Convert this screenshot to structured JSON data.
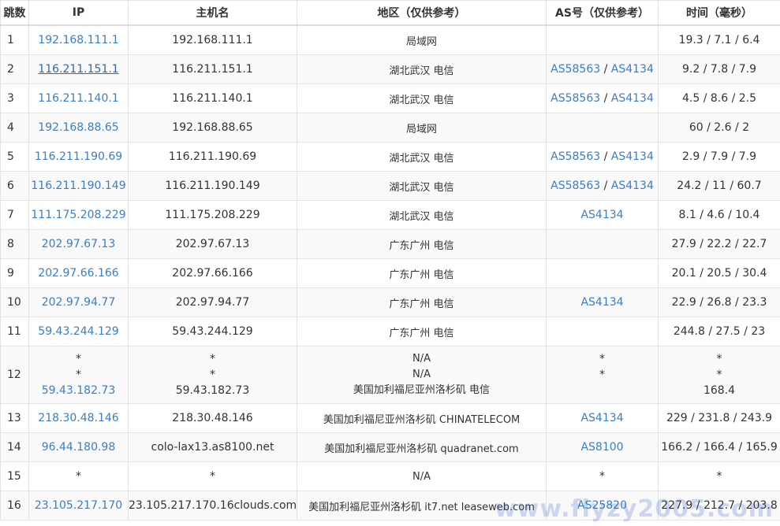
{
  "headers": {
    "hop": "跳数",
    "ip": "IP",
    "hostname": "主机名",
    "region": "地区（仅供参考）",
    "as": "AS号（仅供参考）",
    "time": "时间（毫秒）"
  },
  "rows": [
    {
      "hop": "1",
      "ip": "192.168.111.1",
      "host": "192.168.111.1",
      "region": "局域网",
      "as": [],
      "time": "19.3 / 7.1 / 6.4"
    },
    {
      "hop": "2",
      "ip": "116.211.151.1",
      "host": "116.211.151.1",
      "region": "湖北武汉 电信",
      "as": [
        "AS58563",
        "AS4134"
      ],
      "time": "9.2 / 7.8 / 7.9"
    },
    {
      "hop": "3",
      "ip": "116.211.140.1",
      "host": "116.211.140.1",
      "region": "湖北武汉 电信",
      "as": [
        "AS58563",
        "AS4134"
      ],
      "time": "4.5 / 8.6 / 2.5"
    },
    {
      "hop": "4",
      "ip": "192.168.88.65",
      "host": "192.168.88.65",
      "region": "局域网",
      "as": [],
      "time": "60 / 2.6 / 2"
    },
    {
      "hop": "5",
      "ip": "116.211.190.69",
      "host": "116.211.190.69",
      "region": "湖北武汉 电信",
      "as": [
        "AS58563",
        "AS4134"
      ],
      "time": "2.9 / 7.9 / 7.9"
    },
    {
      "hop": "6",
      "ip": "116.211.190.149",
      "host": "116.211.190.149",
      "region": "湖北武汉 电信",
      "as": [
        "AS58563",
        "AS4134"
      ],
      "time": "24.2 / 11 / 60.7"
    },
    {
      "hop": "7",
      "ip": "111.175.208.229",
      "host": "111.175.208.229",
      "region": "湖北武汉 电信",
      "as": [
        "AS4134"
      ],
      "time": "8.1 / 4.6 / 10.4"
    },
    {
      "hop": "8",
      "ip": "202.97.67.13",
      "host": "202.97.67.13",
      "region": "广东广州 电信",
      "as": [],
      "time": "27.9 / 22.2 / 22.7"
    },
    {
      "hop": "9",
      "ip": "202.97.66.166",
      "host": "202.97.66.166",
      "region": "广东广州 电信",
      "as": [],
      "time": "20.1 / 20.5 / 30.4"
    },
    {
      "hop": "10",
      "ip": "202.97.94.77",
      "host": "202.97.94.77",
      "region": "广东广州 电信",
      "as": [
        "AS4134"
      ],
      "time": "22.9 / 26.8 / 23.3"
    },
    {
      "hop": "11",
      "ip": "59.43.244.129",
      "host": "59.43.244.129",
      "region": "广东广州 电信",
      "as": [],
      "time": "244.8 / 27.5 / 23"
    },
    {
      "hop": "12",
      "multi": true,
      "ip": [
        "*",
        "*",
        "59.43.182.73"
      ],
      "host": [
        "*",
        "*",
        "59.43.182.73"
      ],
      "region": [
        "N/A",
        "N/A",
        "美国加利福尼亚州洛杉矶 电信"
      ],
      "as": [
        "*",
        "*",
        ""
      ],
      "time": [
        "*",
        "*",
        "168.4"
      ]
    },
    {
      "hop": "13",
      "ip": "218.30.48.146",
      "host": "218.30.48.146",
      "region": "美国加利福尼亚州洛杉矶 CHINATELECOM",
      "as": [
        "AS4134"
      ],
      "time": "229 / 231.8 / 243.9"
    },
    {
      "hop": "14",
      "ip": "96.44.180.98",
      "host": "colo-lax13.as8100.net",
      "region": "美国加利福尼亚州洛杉矶 quadranet.com",
      "as": [
        "AS8100"
      ],
      "time": "166.2 / 166.4 / 165.9"
    },
    {
      "hop": "15",
      "ip": "*",
      "ipPlain": true,
      "host": "*",
      "region": "N/A",
      "as": [
        "*"
      ],
      "asPlain": true,
      "time": "*"
    },
    {
      "hop": "16",
      "ip": "23.105.217.170",
      "host": "23.105.217.170.16clouds.com",
      "region": "美国加利福尼亚州洛杉矶 it7.net leaseweb.com",
      "as": [
        "AS25820"
      ],
      "time": "227.9 / 212.7 / 203.8"
    }
  ],
  "watermark": "www.flyzy2005.com"
}
